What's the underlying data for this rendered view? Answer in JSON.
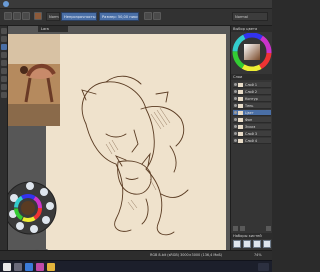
{
  "toolbar": {
    "blend_mode": "Normal",
    "brush_preset": "Normal",
    "opacity_label": "Непрозрачность: 100%",
    "size_label": "Размер: 50,00 пикс."
  },
  "document": {
    "tab_title": "Lara"
  },
  "panels": {
    "color_selector": "Выбор цвета",
    "layers": "Слои",
    "brush_presets": "Наборы кистей"
  },
  "layers": [
    {
      "name": "Слой 1"
    },
    {
      "name": "Слой 2"
    },
    {
      "name": "Контур"
    },
    {
      "name": "Тень"
    },
    {
      "name": "Цвет"
    },
    {
      "name": "Фон"
    },
    {
      "name": "Эскиз"
    },
    {
      "name": "Слой 3"
    },
    {
      "name": "Слой 4"
    }
  ],
  "popup": {
    "tooltip": "Цвет кисти"
  },
  "status": {
    "text": "RGB 8-bit (sRGB)  3000×3000 (136,4 МиБ)",
    "zoom": "74%"
  },
  "colors": {
    "accent": "#4a6fa6",
    "paper": "#efe2cc",
    "line": "#5a3b22"
  }
}
